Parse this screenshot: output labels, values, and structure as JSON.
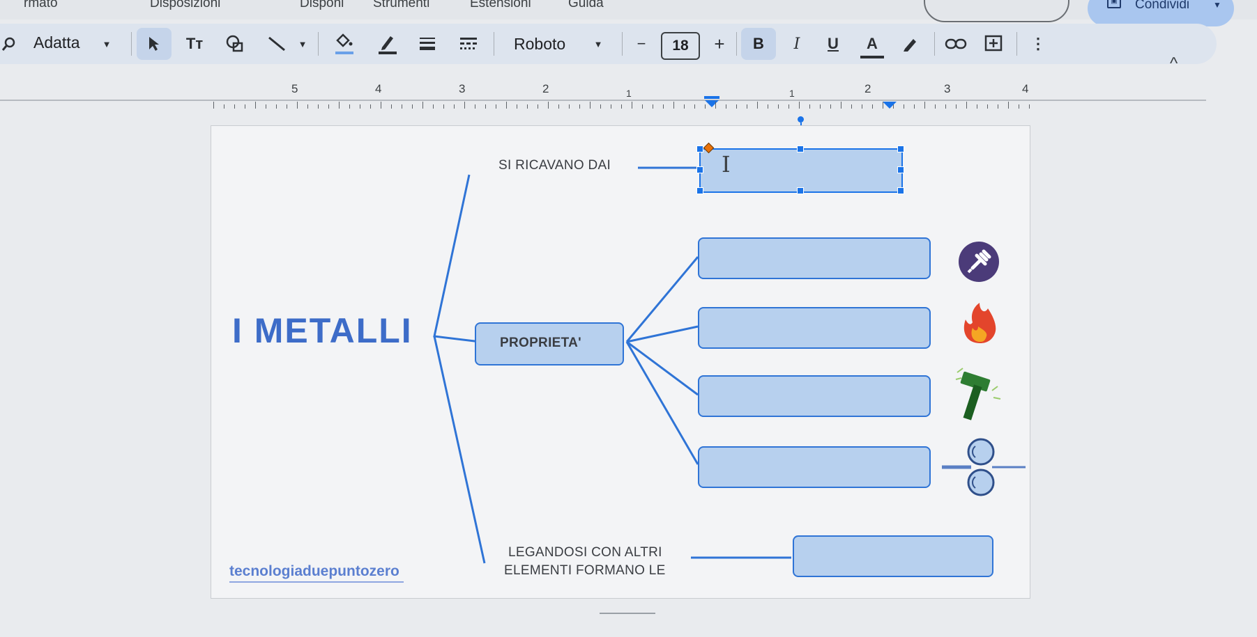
{
  "menubar": {
    "items": [
      "rmato",
      "Disposizioni",
      "Disponi",
      "Strumenti",
      "Estensioni",
      "Guida"
    ],
    "share_label": "Condividi"
  },
  "toolbar": {
    "zoom": "Adatta",
    "font": "Roboto",
    "font_size": "18",
    "bold": "B",
    "italic": "I",
    "underline": "U",
    "text_color": "A",
    "minus": "−",
    "plus": "+",
    "more": "⋮",
    "text_tool": "Tт"
  },
  "ruler": {
    "labels": [
      "5",
      "4",
      "3",
      "2",
      "1",
      "1",
      "2",
      "3",
      "4"
    ]
  },
  "drawing": {
    "title": "I METALLI",
    "label_top": "SI RICAVANO DAI",
    "label_center": "PROPRIETA'",
    "label_bottom_line1": "LEGANDOSI CON ALTRI",
    "label_bottom_line2": "ELEMENTI FORMANO LE",
    "watermark": "tecnologiaduepuntozero",
    "accent_color": "#2f74d6",
    "title_color": "#3d6cc8",
    "box_fill": "#b7d0ee",
    "icons": [
      "plug-icon",
      "fire-icon",
      "hammer-icon",
      "rolling-mill-icon"
    ]
  },
  "collapse_icon": "^"
}
